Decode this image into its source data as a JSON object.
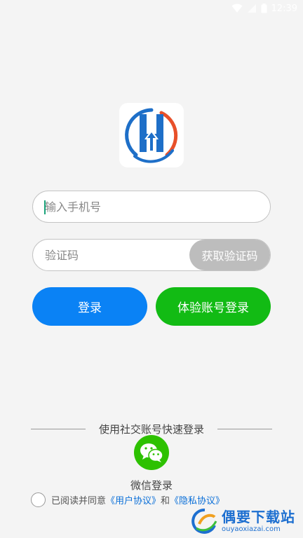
{
  "status_bar": {
    "time": "12:39",
    "icons": [
      "wifi-icon",
      "signal-icon",
      "battery-icon"
    ]
  },
  "logo": {
    "icon": "app-logo-icon"
  },
  "phone": {
    "placeholder": "输入手机号"
  },
  "code": {
    "placeholder": "验证码",
    "get_code_label": "获取验证码"
  },
  "buttons": {
    "login_label": "登录",
    "trial_label": "体验账号登录"
  },
  "social": {
    "divider_text": "使用社交账号快速登录",
    "wechat_label": "微信登录",
    "wechat_icon": "wechat-icon"
  },
  "agreement": {
    "prefix": "已阅读并同意",
    "user_agreement": "《用户协议》",
    "and": "和",
    "privacy_agreement": "《隐私协议》"
  },
  "watermark": {
    "title": "偶要下载站",
    "subtitle": "ouyaoxiazai.com"
  },
  "colors": {
    "login": "#0a82f5",
    "trial": "#12bb14",
    "get_code": "#bdbdbd",
    "wechat": "#2dc100",
    "link": "#0a6fd8"
  }
}
